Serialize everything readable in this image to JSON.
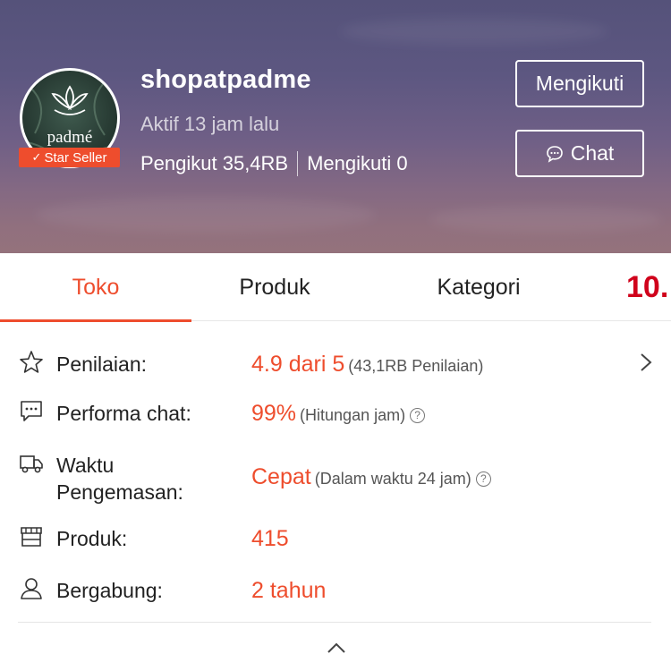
{
  "header": {
    "shop_name": "shopatpadme",
    "avatar_text": "padmé",
    "badge": "Star Seller",
    "active_status": "Aktif 13 jam lalu",
    "followers": "Pengikut 35,4RB",
    "following": "Mengikuti 0",
    "follow_button": "Mengikuti",
    "chat_button": "Chat"
  },
  "tabs": [
    {
      "label": "Toko",
      "active": true
    },
    {
      "label": "Produk"
    },
    {
      "label": "Kategori"
    },
    {
      "label": "10."
    }
  ],
  "info": {
    "rating": {
      "label": "Penilaian:",
      "value": "4.9 dari 5",
      "note": "(43,1RB Penilaian)"
    },
    "chat_performance": {
      "label": "Performa chat:",
      "value": "99%",
      "note": "(Hitungan jam)"
    },
    "packing_time": {
      "label_line1": "Waktu",
      "label_line2": "Pengemasan:",
      "value": "Cepat",
      "note": "(Dalam waktu 24 jam)"
    },
    "products": {
      "label": "Produk:",
      "value": "415"
    },
    "joined": {
      "label": "Bergabung:",
      "value": "2 tahun"
    }
  },
  "icons": {
    "rating": "star-outline-icon",
    "chat": "chat-bubble-icon",
    "packing": "delivery-truck-icon",
    "products": "storefront-icon",
    "joined": "user-icon",
    "help": "question-circle-icon",
    "more": "chevron-right-icon",
    "collapse": "chevron-up-icon"
  },
  "colors": {
    "accent": "#ee4d2d",
    "tab_overflow": "#d0011b"
  }
}
